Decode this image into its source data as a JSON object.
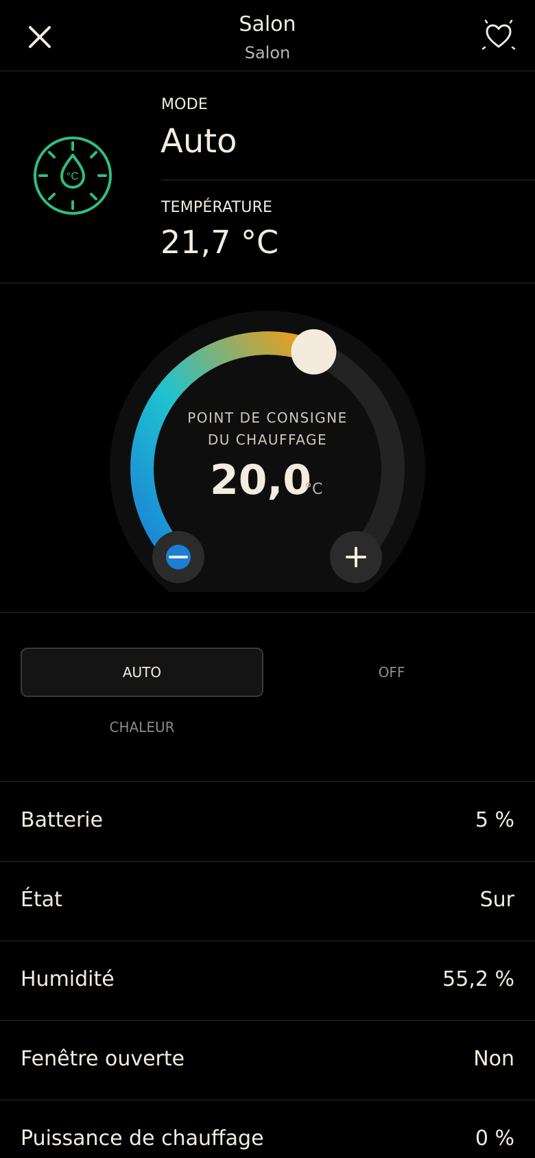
{
  "header": {
    "title": "Salon",
    "subtitle": "Salon",
    "close_icon": "close-icon",
    "favorite_icon": "heart-sparkle-icon"
  },
  "status": {
    "device_icon": "thermostat-dial-icon",
    "mode_label": "MODE",
    "mode_value": "Auto",
    "temperature_label": "TEMPÉRATURE",
    "temperature_value": "21,7 °C"
  },
  "dial": {
    "label_line1": "POINT DE CONSIGNE",
    "label_line2": "DU CHAUFFAGE",
    "value": "20,0",
    "unit": "°C",
    "level_fraction": 0.58,
    "minus_icon": "minus-icon",
    "plus_icon": "plus-icon",
    "colors": {
      "cold": "#1b7fd6",
      "mid": "#1fc3cf",
      "warm": "#f39c12",
      "handle": "#f5ebdc",
      "track": "#232323"
    }
  },
  "modes": {
    "auto": "AUTO",
    "off": "OFF",
    "heat": "CHALEUR",
    "selected": "AUTO"
  },
  "attributes": [
    {
      "name": "Batterie",
      "value": "5  %"
    },
    {
      "name": "État",
      "value": "Sur"
    },
    {
      "name": "Humidité",
      "value": "55,2  %"
    },
    {
      "name": "Fenêtre ouverte",
      "value": "Non"
    },
    {
      "name": "Puissance de chauffage",
      "value": "0  %"
    }
  ],
  "colors": {
    "background": "#000000",
    "text": "#f3ecdf",
    "accent_green": "#2fbf7d"
  }
}
